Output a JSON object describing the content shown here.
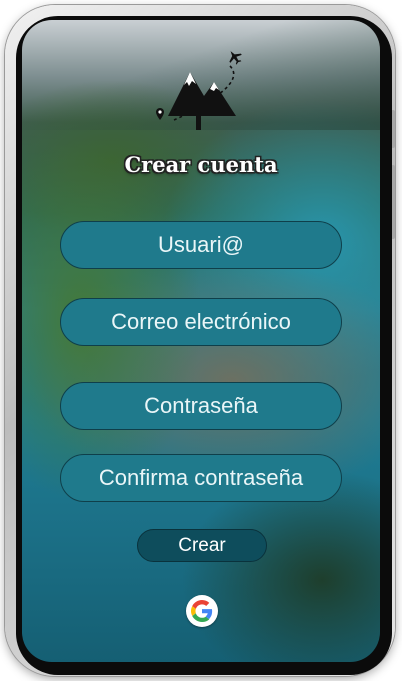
{
  "screen": {
    "title": "Crear cuenta"
  },
  "form": {
    "username_placeholder": "Usuari@",
    "email_placeholder": "Correo electrónico",
    "password_placeholder": "Contraseña",
    "confirm_password_placeholder": "Confirma contraseña"
  },
  "actions": {
    "create_label": "Crear",
    "google_icon": "google-icon"
  },
  "colors": {
    "field_fill": "#1f7a8c",
    "button_fill": "#0e4d5c",
    "field_text": "#eaf6f8"
  },
  "logo": {
    "icon": "mountain-travel-logo"
  }
}
